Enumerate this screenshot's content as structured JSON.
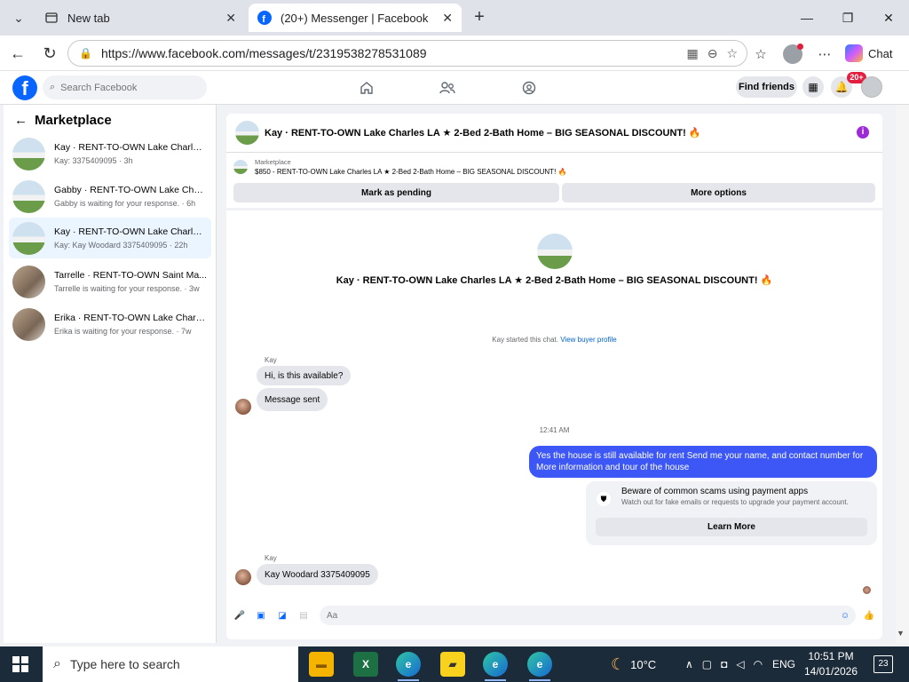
{
  "browser": {
    "tabs": [
      {
        "title": "New tab",
        "icon": "newtab-icon"
      },
      {
        "title": "(20+) Messenger | Facebook",
        "icon": "facebook-icon"
      }
    ],
    "url": "https://www.facebook.com/messages/t/2319538278531089",
    "chat_label": "Chat"
  },
  "fb": {
    "search_placeholder": "Search Facebook",
    "find_friends": "Find friends",
    "notification_badge": "20+",
    "brand_color": "#0866ff"
  },
  "sidebar": {
    "title": "Marketplace",
    "conversations": [
      {
        "name": "Kay · RENT-TO-OWN Lake Charles ...",
        "snippet": "Kay: 3375409095 · 3h",
        "thumb": "house"
      },
      {
        "name": "Gabby · RENT-TO-OWN Lake Charl...",
        "snippet": "Gabby is waiting for your response. · 6h",
        "thumb": "house"
      },
      {
        "name": "Kay · RENT-TO-OWN Lake Charles ...",
        "snippet": "Kay: Kay Woodard 3375409095 · 22h",
        "thumb": "house",
        "selected": true
      },
      {
        "name": "Tarrelle · RENT-TO-OWN Saint Ma...",
        "snippet": "Tarrelle is waiting for your response. · 3w",
        "thumb": "room"
      },
      {
        "name": "Erika · RENT-TO-OWN Lake Charle...",
        "snippet": "Erika is waiting for your response. · 7w",
        "thumb": "room"
      }
    ]
  },
  "chat": {
    "title": "Kay · RENT-TO-OWN Lake Charles LA ★ 2-Bed 2-Bath Home – BIG SEASONAL DISCOUNT! 🔥",
    "marketplace_label": "Marketplace",
    "listing": "$850 - RENT-TO-OWN Lake Charles LA ★ 2-Bed 2-Bath Home – BIG SEASONAL DISCOUNT! 🔥",
    "mark_pending": "Mark as pending",
    "more_options": "More options",
    "started_text": "Kay started this chat.",
    "view_profile": "View buyer profile",
    "sender1": "Kay",
    "msg1": "Hi, is this available?",
    "msg2": "Message sent",
    "time": "12:41 AM",
    "my_msg": "Yes the house is still available for rent Send me your name, and contact number for More information and tour of the house",
    "scam_title": "Beware of common scams using payment apps",
    "scam_sub": "Watch out for fake emails or requests to upgrade your payment account.",
    "learn_more": "Learn More",
    "sender2": "Kay",
    "msg3": "Kay Woodard 3375409095",
    "composer_placeholder": "Aa",
    "my_bubble_color": "#3c57f5"
  },
  "taskbar": {
    "search_placeholder": "Type here to search",
    "weather": "10°C",
    "lang": "ENG",
    "time": "10:51 PM",
    "date": "14/01/2026",
    "notifications": "23"
  }
}
